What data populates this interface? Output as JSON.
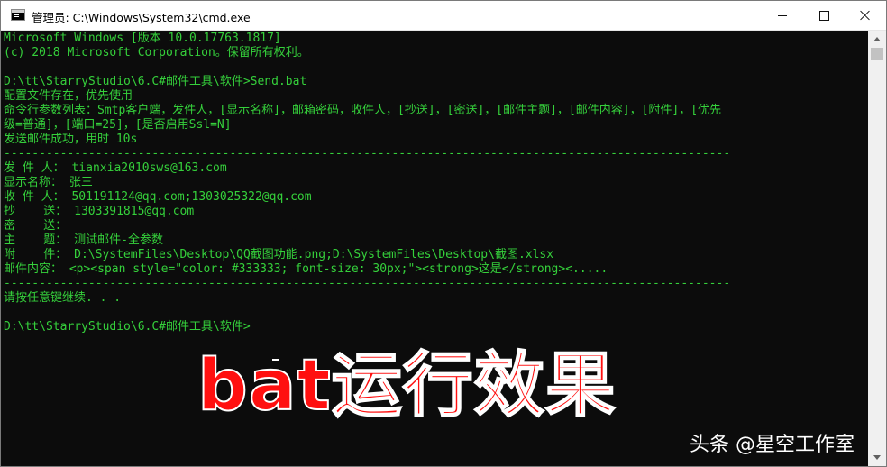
{
  "window": {
    "title": "管理员: C:\\Windows\\System32\\cmd.exe"
  },
  "console": {
    "lines": [
      "Microsoft Windows [版本 10.0.17763.1817]",
      "(c) 2018 Microsoft Corporation。保留所有权利。",
      "",
      "D:\\tt\\StarryStudio\\6.C#邮件工具\\软件>Send.bat",
      "配置文件存在，优先使用",
      "命令行参数列表：Smtp客户端，发件人，[显示名称]，邮箱密码，收件人，[抄送]，[密送]，[邮件主题]，[邮件内容]，[附件]，[优先",
      "级=普通]，[端口=25]，[是否启用Ssl=N]",
      "发送邮件成功，用时 10s",
      "-------------------------------------------------------------------------------------------------------",
      "发 件 人： tianxia2010sws@163.com",
      "显示名称： 张三",
      "收 件 人： 501191124@qq.com;1303025322@qq.com",
      "抄    送： 1303391815@qq.com",
      "密    送：",
      "主    题： 测试邮件-全参数",
      "附    件： D:\\SystemFiles\\Desktop\\QQ截图功能.png;D:\\SystemFiles\\Desktop\\截图.xlsx",
      "邮件内容： <p><span style=\"color: #333333; font-size: 30px;\"><strong>这是</strong><.....",
      "-------------------------------------------------------------------------------------------------------",
      "请按任意键继续. . .",
      "",
      "D:\\tt\\StarryStudio\\6.C#邮件工具\\软件>"
    ]
  },
  "overlay": {
    "caption": "bat运行效果",
    "watermark": "头条 @星空工作室"
  },
  "colors": {
    "console_text": "#35d03b",
    "console_bg": "#0c0c0c",
    "caption": "#ff1010"
  },
  "icons": {
    "app": "cmd-icon",
    "minimize": "minimize-icon",
    "maximize": "maximize-icon",
    "close": "close-icon"
  }
}
